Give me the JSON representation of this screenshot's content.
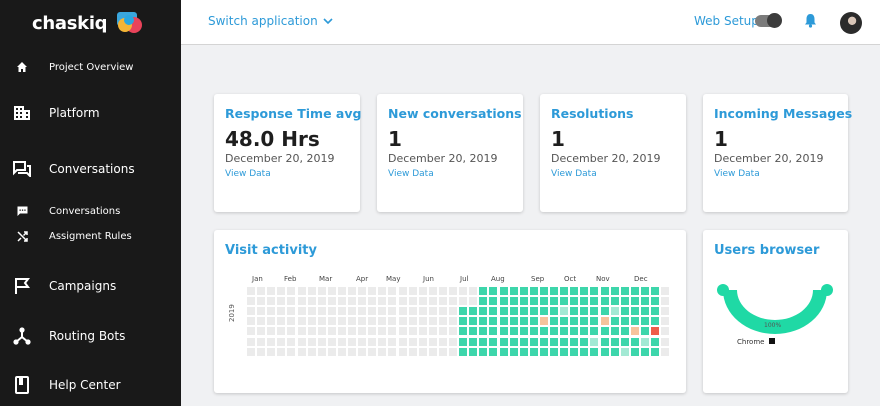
{
  "app": {
    "logo_text": "chaskiq"
  },
  "sidebar": {
    "items": [
      {
        "label": "Project Overview",
        "icon": "home-icon"
      },
      {
        "label": "Platform",
        "icon": "building-icon"
      },
      {
        "label": "Conversations",
        "icon": "chat-icon"
      },
      {
        "label": "Conversations",
        "icon": "chat-bubble-icon"
      },
      {
        "label": "Assigment Rules",
        "icon": "shuffle-icon"
      },
      {
        "label": "Campaigns",
        "icon": "flag-icon"
      },
      {
        "label": "Routing Bots",
        "icon": "bot-network-icon"
      },
      {
        "label": "Help Center",
        "icon": "book-icon"
      }
    ]
  },
  "topbar": {
    "switch_app_label": "Switch application",
    "web_setup_label": "Web Setup",
    "colors": {
      "accent": "#2d9ad8"
    }
  },
  "stats": [
    {
      "title": "Response Time avg",
      "value": "48.0 Hrs",
      "date": "December 20, 2019",
      "link": "View Data"
    },
    {
      "title": "New conversations",
      "value": "1",
      "date": "December 20, 2019",
      "link": "View Data"
    },
    {
      "title": "Resolutions",
      "value": "1",
      "date": "December 20, 2019",
      "link": "View Data"
    },
    {
      "title": "Incoming Messages",
      "value": "1",
      "date": "December 20, 2019",
      "link": "View Data"
    }
  ],
  "visit_activity": {
    "title": "Visit activity",
    "year": "2019",
    "months": [
      "Jan",
      "Feb",
      "Mar",
      "Apr",
      "May",
      "Jun",
      "Jul",
      "Aug",
      "Sep",
      "Oct",
      "Nov",
      "Dec"
    ],
    "colors": {
      "empty": "#ebebeb",
      "active": "#3dd6ab",
      "light": "#a3e9d4",
      "peach": "#f6c39d",
      "hot": "#ee5d4a"
    }
  },
  "users_browser": {
    "title": "Users browser",
    "legend_label": "Chrome",
    "percent_label": "100%",
    "colors": {
      "arc": "#1fd9a5"
    }
  }
}
